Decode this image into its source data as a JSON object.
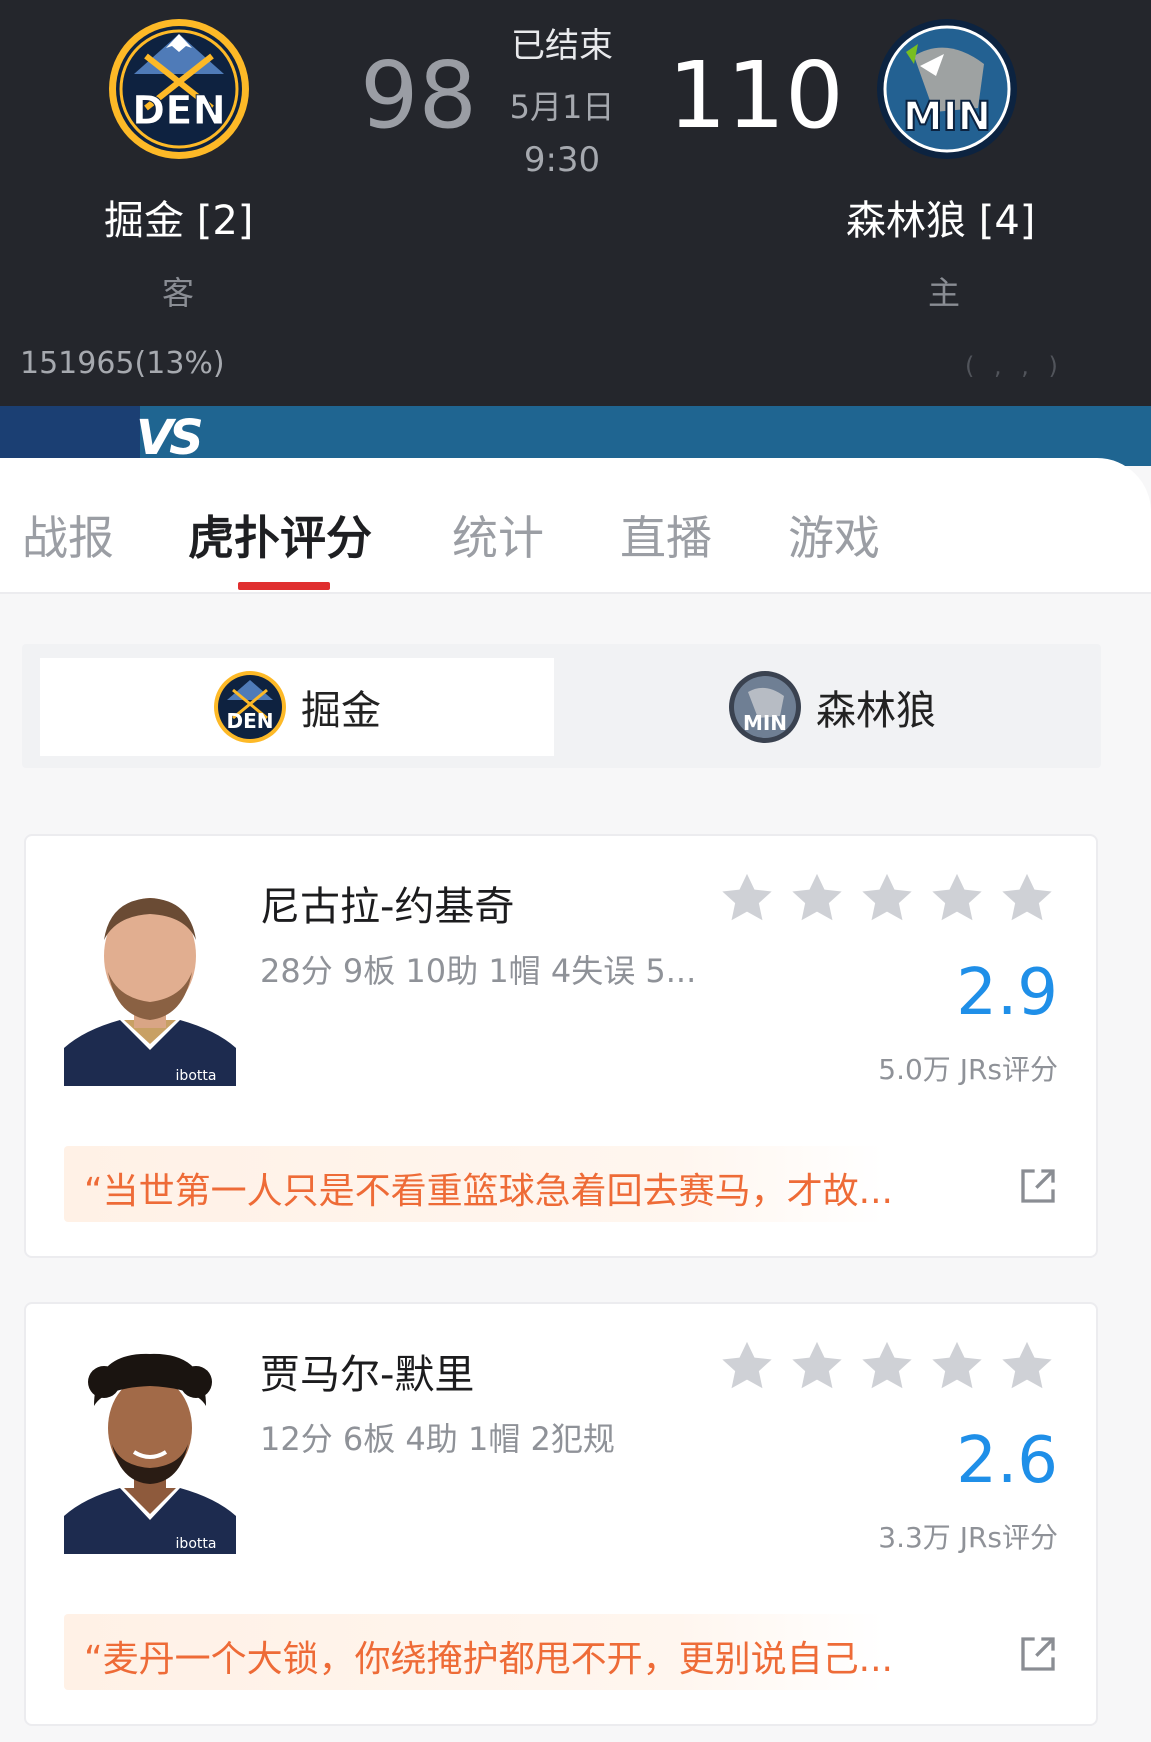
{
  "match": {
    "status": "已结束",
    "date": "5月1日",
    "time": "9:30",
    "away": {
      "abbr": "DEN",
      "name": "掘金 [2]",
      "role": "客",
      "score": "98"
    },
    "home": {
      "abbr": "MIN",
      "name": "森林狼 [4]",
      "role": "主",
      "score": "110"
    },
    "support_away": "151965(13%)",
    "support_home": "( ,  , )",
    "vs_label": "VS"
  },
  "tabs": [
    {
      "label": "战报",
      "active": false
    },
    {
      "label": "虎扑评分",
      "active": true
    },
    {
      "label": "统计",
      "active": false
    },
    {
      "label": "直播",
      "active": false
    },
    {
      "label": "游戏",
      "active": false
    }
  ],
  "team_switch": {
    "den": {
      "label": "掘金",
      "logo_text": "DEN"
    },
    "min": {
      "label": "森林狼",
      "logo_text": "MIN"
    }
  },
  "players": [
    {
      "name": "尼古拉-约基奇",
      "stats": "28分 9板 10助 1帽 4失误 5...",
      "rating": "2.9",
      "rating_count": "5.0万 JRs评分",
      "stars_filled": 0,
      "comment": "“当世第一人只是不看重篮球急着回去赛马，才故...",
      "jersey_text": "ibotta"
    },
    {
      "name": "贾马尔-默里",
      "stats": "12分 6板 4助 1帽 2犯规",
      "rating": "2.6",
      "rating_count": "3.3万 JRs评分",
      "stars_filled": 0,
      "comment": "“麦丹一个大锁，你绕掩护都甩不开，更别说自己...",
      "jersey_text": "ibotta"
    }
  ],
  "colors": {
    "header_bg": "#24262c",
    "accent_red": "#e02f2f",
    "rating_blue": "#1f8fe8",
    "comment_orange": "#ee6b37",
    "vs_band": "#1f6591"
  },
  "icons": {
    "share": "external-share-icon",
    "star": "star-icon"
  }
}
